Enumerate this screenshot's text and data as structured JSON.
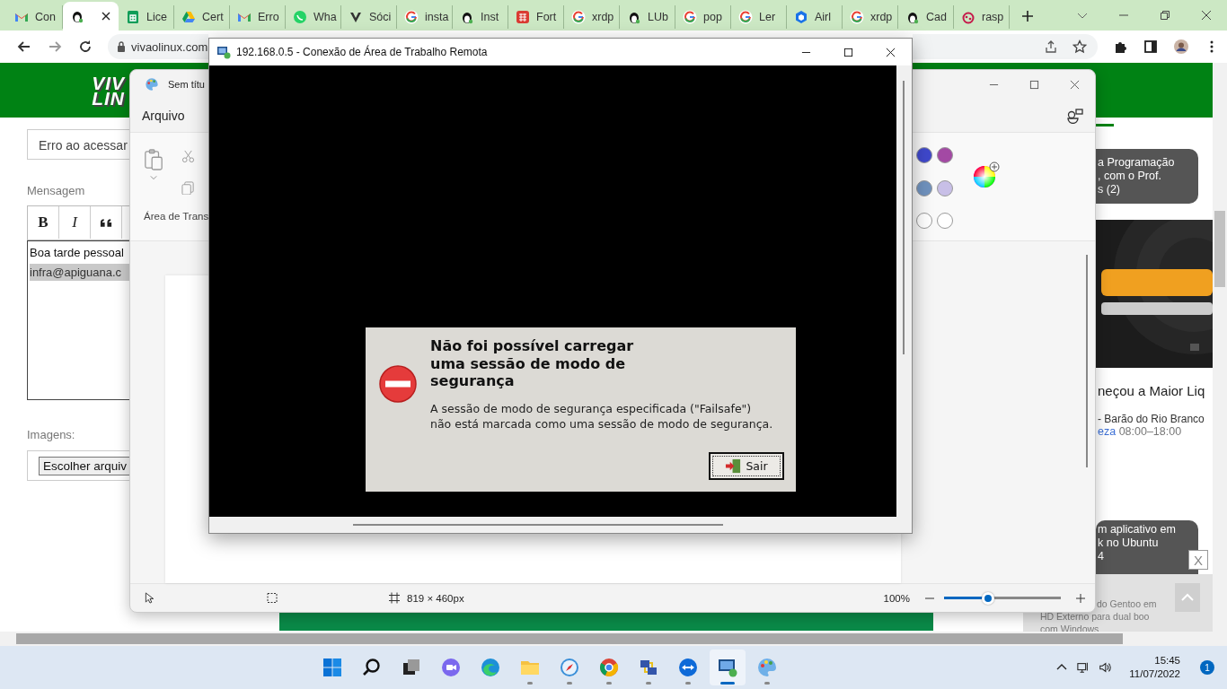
{
  "browser": {
    "tabs": [
      {
        "kind": "gmail",
        "label": "Con",
        "selected": false
      },
      {
        "kind": "tux",
        "selected": true
      },
      {
        "kind": "sheets",
        "label": "Lice",
        "selected": false
      },
      {
        "kind": "drive",
        "label": "Cert",
        "selected": false
      },
      {
        "kind": "gmail",
        "label": "Erro",
        "selected": false
      },
      {
        "kind": "whatsapp",
        "label": "Wha",
        "selected": false
      },
      {
        "kind": "shield",
        "label": "Sóci",
        "selected": false
      },
      {
        "kind": "google",
        "label": "insta",
        "selected": false
      },
      {
        "kind": "tux",
        "label": "Inst",
        "selected": false
      },
      {
        "kind": "grid",
        "label": "Fort",
        "selected": false
      },
      {
        "kind": "google",
        "label": "xrdp",
        "selected": false
      },
      {
        "kind": "tux",
        "label": "LUb",
        "selected": false
      },
      {
        "kind": "google",
        "label": "pop",
        "selected": false
      },
      {
        "kind": "google",
        "label": "Ler",
        "selected": false
      },
      {
        "kind": "hex",
        "label": "Airl",
        "selected": false
      },
      {
        "kind": "google",
        "label": "xrdp",
        "selected": false
      },
      {
        "kind": "tux",
        "label": "Cad",
        "selected": false
      },
      {
        "kind": "berry",
        "label": "rasp",
        "selected": false
      }
    ],
    "address": "vivaolinux.com"
  },
  "page": {
    "logo": [
      "VIV",
      "LIN"
    ],
    "subject_value": "Erro ao acessar",
    "message_label": "Mensagem",
    "editor_buttons": [
      {
        "kind": "bold",
        "label": "B"
      },
      {
        "kind": "italic",
        "label": "I"
      },
      {
        "kind": "quote"
      }
    ],
    "message_lines": [
      {
        "text": "Boa tarde pessoal",
        "highlighted": false
      },
      {
        "text": "infra@apiguana.c",
        "highlighted": true
      }
    ],
    "images_label": "Imagens:",
    "file_button": "Escolher arquiv",
    "sidebar_card_1": [
      "a Programação",
      ", com o Prof.",
      "s (2)"
    ],
    "article_title": "neçou a Maior Liq",
    "store_line": "- Barão do Rio Branco",
    "store_link": "eza",
    "store_hours": "08:00–18:00",
    "sidebar_card_2": [
      "m aplicativo em",
      "k no Ubuntu",
      "4"
    ],
    "overlay_lines": [
      "do Gentoo em",
      "HD Externo para dual boo",
      "com Windows"
    ],
    "overlay_close": "X"
  },
  "paint": {
    "title": "Sem títu",
    "menu": "Arquivo",
    "clipboard_label": "Área de Trans",
    "palette": [
      {
        "color": "#3f48cc"
      },
      {
        "color": "#a349a4"
      },
      {
        "color": "#7092be"
      },
      {
        "color": "#c8bfe7"
      },
      {
        "color": "#ffffff"
      },
      {
        "color": "#ffffff"
      }
    ],
    "canvas_size": "819 × 460px",
    "zoom": "100%",
    "zoom_slider": {
      "level": 0.38
    }
  },
  "rdp": {
    "title": "192.168.0.5 - Conexão de Área de Trabalho Remota",
    "dialog": {
      "heading": "Não foi possível carregar\numa sessão de modo de\nsegurança",
      "message": "A sessão de modo de segurança especificada (\"Failsafe\")\nnão está marcada como uma sessão de modo de segurança.",
      "button": "Sair"
    }
  },
  "taskbar": {
    "apps": [
      {
        "kind": "start",
        "running": false,
        "active": false
      },
      {
        "kind": "search",
        "running": false,
        "active": false
      },
      {
        "kind": "taskview",
        "running": false,
        "active": false
      },
      {
        "kind": "chat",
        "running": false,
        "active": false
      },
      {
        "kind": "edge",
        "running": false,
        "active": false
      },
      {
        "kind": "folder",
        "running": true,
        "active": false
      },
      {
        "kind": "compass",
        "running": true,
        "active": false
      },
      {
        "kind": "chrome",
        "running": true,
        "active": false
      },
      {
        "kind": "network",
        "running": true,
        "active": false
      },
      {
        "kind": "teamviewer",
        "running": true,
        "active": false
      },
      {
        "kind": "rdp",
        "running": true,
        "active": true
      },
      {
        "kind": "paint",
        "running": true,
        "active": false
      }
    ],
    "time": "15:45",
    "date": "11/07/2022",
    "notifications": "1"
  }
}
